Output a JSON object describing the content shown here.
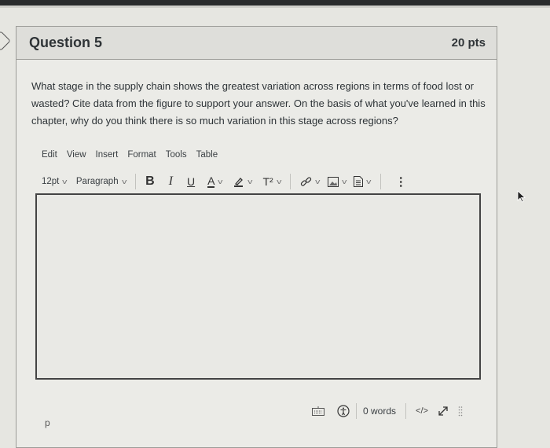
{
  "question": {
    "title": "Question 5",
    "points": "20 pts",
    "text": "What stage in the supply chain shows the greatest variation across regions in terms of food lost or wasted? Cite data from the figure to support your answer.  On the basis of what you've learned in this chapter, why do you think there is so much variation in this stage across regions?"
  },
  "editor": {
    "menu": [
      "Edit",
      "View",
      "Insert",
      "Format",
      "Tools",
      "Table"
    ],
    "font_size": "12pt",
    "block_format": "Paragraph",
    "buttons": {
      "bold": "B",
      "italic": "I",
      "underline": "U",
      "text_color": "A",
      "superscript": "T²",
      "more": "⋮"
    },
    "content": "",
    "path": "p",
    "word_count": "0 words",
    "html_toggle": "</>"
  }
}
